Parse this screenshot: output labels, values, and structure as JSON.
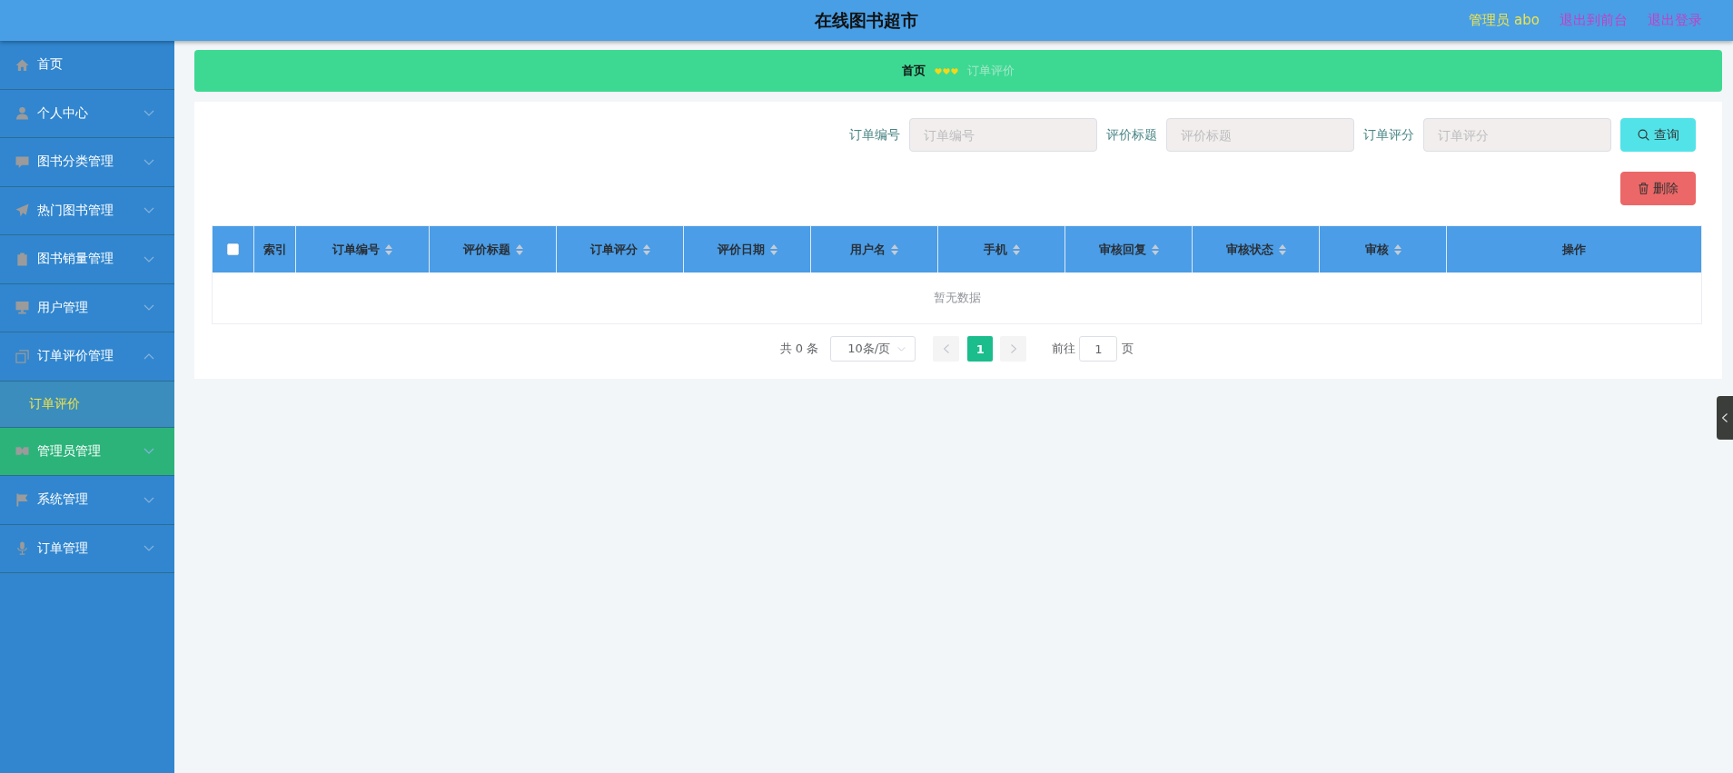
{
  "header": {
    "title": "在线图书超市",
    "user": "管理员 abo",
    "links": [
      "退出到前台",
      "退出登录"
    ]
  },
  "sidebar": {
    "items": [
      {
        "label": "首页",
        "kind": "link",
        "hovered": false
      },
      {
        "label": "个人中心",
        "kind": "menu",
        "expanded": false,
        "hovered": false
      },
      {
        "label": "图书分类管理",
        "kind": "menu",
        "expanded": false,
        "hovered": false
      },
      {
        "label": "热门图书管理",
        "kind": "menu",
        "expanded": false,
        "hovered": false
      },
      {
        "label": "图书销量管理",
        "kind": "menu",
        "expanded": false,
        "hovered": false
      },
      {
        "label": "用户管理",
        "kind": "menu",
        "expanded": false,
        "hovered": false
      },
      {
        "label": "订单评价管理",
        "kind": "menu",
        "expanded": true,
        "hovered": false,
        "children": [
          {
            "label": "订单评价",
            "selected": true
          }
        ]
      },
      {
        "label": "管理员管理",
        "kind": "menu",
        "expanded": false,
        "hovered": true
      },
      {
        "label": "系统管理",
        "kind": "menu",
        "expanded": false,
        "hovered": false
      },
      {
        "label": "订单管理",
        "kind": "menu",
        "expanded": false,
        "hovered": false
      }
    ]
  },
  "breadcrumb": {
    "items": [
      {
        "label": "首页",
        "current": false
      },
      {
        "label": "订单评价",
        "current": true
      }
    ]
  },
  "search": {
    "fields": [
      {
        "label": "订单编号",
        "placeholder": "订单编号"
      },
      {
        "label": "评价标题",
        "placeholder": "评价标题"
      },
      {
        "label": "订单评分",
        "placeholder": "订单评分"
      }
    ],
    "buttons": [
      {
        "label": "查询",
        "kind": "search"
      },
      {
        "label": "删除",
        "kind": "delete"
      }
    ]
  },
  "table": {
    "select_all": {
      "checked": false
    },
    "columns": [
      {
        "label": "索引",
        "sortable": false
      },
      {
        "label": "订单编号",
        "sortable": true
      },
      {
        "label": "评价标题",
        "sortable": true
      },
      {
        "label": "订单评分",
        "sortable": true
      },
      {
        "label": "评价日期",
        "sortable": true
      },
      {
        "label": "用户名",
        "sortable": true
      },
      {
        "label": "手机",
        "sortable": true
      },
      {
        "label": "审核回复",
        "sortable": true
      },
      {
        "label": "审核状态",
        "sortable": true
      },
      {
        "label": "审核",
        "sortable": true
      },
      {
        "label": "操作",
        "sortable": false
      }
    ],
    "empty_text": "暂无数据"
  },
  "pagination": {
    "total": "共 0 条",
    "page_size": "10条/页",
    "prev": {
      "disabled": true
    },
    "pages": [
      {
        "label": "1",
        "selected": true
      }
    ],
    "next": {
      "disabled": true
    },
    "goto_label": "前往",
    "goto_value": "1",
    "goto_suffix": "页"
  }
}
